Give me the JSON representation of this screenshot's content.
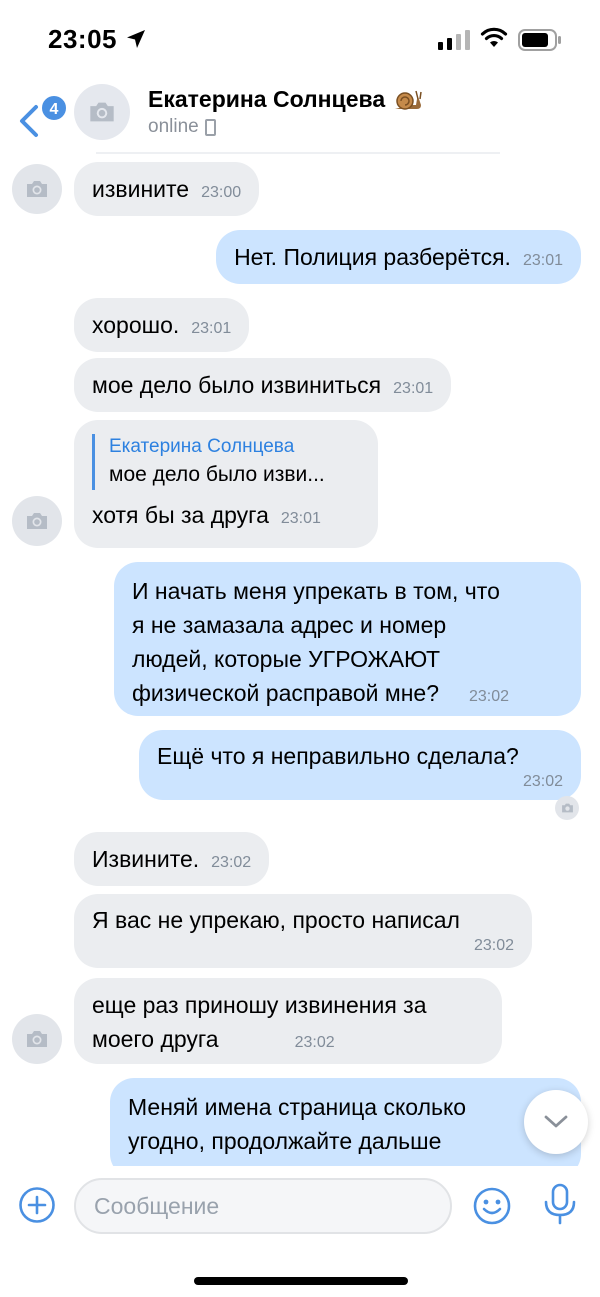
{
  "status_bar": {
    "time": "23:05"
  },
  "header": {
    "back_badge": "4",
    "contact_name": "Екатерина Солнцева",
    "status": "online"
  },
  "messages": [
    {
      "direction": "in",
      "text": "извините",
      "time": "23:00"
    },
    {
      "direction": "out",
      "text": "Нет. Полиция разберётся.",
      "time": "23:01"
    },
    {
      "direction": "in",
      "text": "хорошо.",
      "time": "23:01"
    },
    {
      "direction": "in",
      "text": "мое дело было извиниться",
      "time": "23:01"
    },
    {
      "direction": "in",
      "quote_author": "Екатерина Солнцева",
      "quote_text": "мое дело было изви...",
      "text": "хотя бы за друга",
      "time": "23:01"
    },
    {
      "direction": "out",
      "lines": [
        "И начать меня упрекать в том, что",
        "я не замазала адрес и номер",
        "людей, которые УГРОЖАЮТ",
        "физической расправой мне?"
      ],
      "time": "23:02"
    },
    {
      "direction": "out",
      "text": "Ещё что я неправильно сделала?",
      "time": "23:02"
    },
    {
      "direction": "in",
      "text": "Извините.",
      "time": "23:02"
    },
    {
      "direction": "in",
      "text": "Я вас не упрекаю, просто написал",
      "time": "23:02"
    },
    {
      "direction": "in",
      "lines": [
        "еще раз приношу извинения за",
        "моего друга"
      ],
      "time": "23:02"
    },
    {
      "direction": "out",
      "lines": [
        "Меняй имена страница сколько",
        "угодно, продолжайте дальше"
      ],
      "time": ""
    }
  ],
  "composer": {
    "placeholder": "Сообщение"
  },
  "colors": {
    "incoming_bubble": "#ebedf0",
    "outgoing_bubble": "#cce4ff",
    "accent": "#4a90e2",
    "timestamp": "#818c99"
  },
  "icons": [
    "location-arrow-icon",
    "signal-icon",
    "wifi-icon",
    "battery-icon",
    "back-chevron-icon",
    "camera-icon",
    "snail-icon",
    "phone-icon",
    "chevron-down-icon",
    "plus-icon",
    "emoji-icon",
    "microphone-icon"
  ]
}
